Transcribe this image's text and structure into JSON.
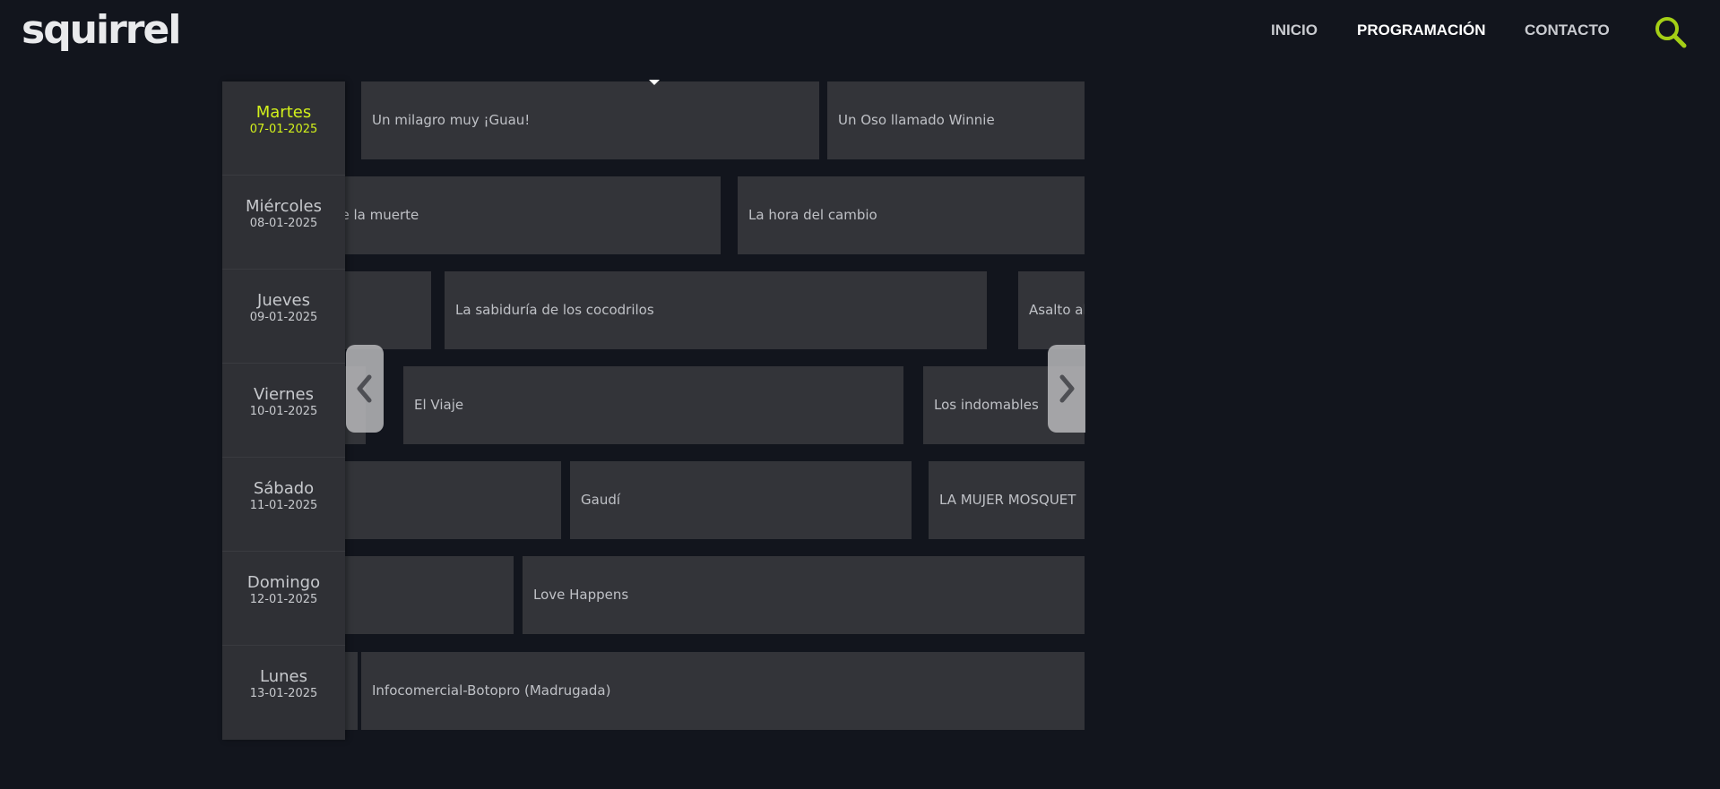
{
  "brand": {
    "logo_text": "squirrel",
    "accent_color": "#d2f01b"
  },
  "nav": {
    "items": [
      {
        "label": "INICIO",
        "active": false
      },
      {
        "label": "PROGRAMACIÓN",
        "active": true
      },
      {
        "label": "CONTACTO",
        "active": false
      }
    ],
    "search_icon": "search-icon"
  },
  "days": [
    {
      "name": "Martes",
      "date": "07-01-2025",
      "active": true
    },
    {
      "name": "Miércoles",
      "date": "08-01-2025",
      "active": false
    },
    {
      "name": "Jueves",
      "date": "09-01-2025",
      "active": false
    },
    {
      "name": "Viernes",
      "date": "10-01-2025",
      "active": false
    },
    {
      "name": "Sábado",
      "date": "11-01-2025",
      "active": false
    },
    {
      "name": "Domingo",
      "date": "12-01-2025",
      "active": false
    },
    {
      "name": "Lunes",
      "date": "13-01-2025",
      "active": false
    }
  ],
  "schedule": {
    "martes": [
      "Un milagro muy ¡Guau!",
      "Un Oso llamado Winnie"
    ],
    "miercoles": [
      "o de la muerte",
      "La hora del cambio"
    ],
    "jueves": [
      "La sabiduría de los cocodrilos",
      "Asalto al"
    ],
    "viernes": [
      "El Viaje",
      "Los indomables"
    ],
    "sabado": [
      "Gaudí",
      "LA MUJER MOSQUET"
    ],
    "domingo": [
      "Love Happens"
    ],
    "lunes": [
      "Infocomercial-Botopro (Madrugada)"
    ]
  },
  "controls": {
    "prev_icon": "chevron-left-icon",
    "next_icon": "chevron-right-icon"
  }
}
